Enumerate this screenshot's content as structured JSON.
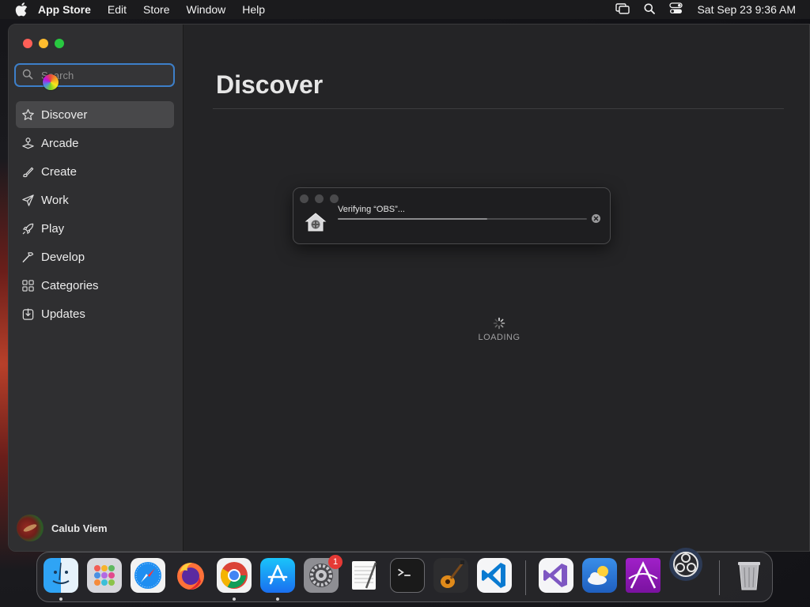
{
  "menubar": {
    "app_name": "App Store",
    "menus": [
      "Edit",
      "Store",
      "Window",
      "Help"
    ],
    "clock": "Sat Sep 23  9:36 AM"
  },
  "sidebar": {
    "search_placeholder": "Search",
    "items": [
      {
        "label": "Discover",
        "icon": "star-icon",
        "active": true
      },
      {
        "label": "Arcade",
        "icon": "joystick-icon",
        "active": false
      },
      {
        "label": "Create",
        "icon": "brush-icon",
        "active": false
      },
      {
        "label": "Work",
        "icon": "paperplane-icon",
        "active": false
      },
      {
        "label": "Play",
        "icon": "rocket-icon",
        "active": false
      },
      {
        "label": "Develop",
        "icon": "hammer-icon",
        "active": false
      },
      {
        "label": "Categories",
        "icon": "grid-icon",
        "active": false
      },
      {
        "label": "Updates",
        "icon": "download-icon",
        "active": false
      }
    ],
    "user_name": "Calub Viem"
  },
  "main": {
    "title": "Discover",
    "loading_text": "LOADING"
  },
  "verify_dialog": {
    "text": "Verifying “OBS”...",
    "progress": 0.6
  },
  "dock": {
    "apps": [
      {
        "name": "Finder",
        "icon": "finder-icon",
        "running": true
      },
      {
        "name": "Launchpad",
        "icon": "launchpad-icon",
        "running": false
      },
      {
        "name": "Safari",
        "icon": "safari-icon",
        "running": false
      },
      {
        "name": "Firefox",
        "icon": "firefox-icon",
        "running": false
      },
      {
        "name": "Chrome",
        "icon": "chrome-icon",
        "running": true
      },
      {
        "name": "App Store",
        "icon": "appstore-icon",
        "running": true
      },
      {
        "name": "System Settings",
        "icon": "settings-icon",
        "running": false,
        "badge": "1"
      },
      {
        "name": "TextEdit",
        "icon": "textedit-icon",
        "running": false
      },
      {
        "name": "Terminal",
        "icon": "terminal-icon",
        "running": false
      },
      {
        "name": "GarageBand",
        "icon": "guitar-icon",
        "running": false
      },
      {
        "name": "VS Code",
        "icon": "vscode-icon",
        "running": false
      },
      {
        "name": "Visual Studio",
        "icon": "visualstudio-icon",
        "running": false
      },
      {
        "name": "Weather",
        "icon": "weather-icon",
        "running": false
      },
      {
        "name": "Affinity",
        "icon": "affinity-icon",
        "running": false
      },
      {
        "name": "OBS",
        "icon": "obs-icon",
        "running": false
      },
      {
        "name": "Trash",
        "icon": "trash-icon",
        "running": false
      }
    ]
  },
  "colors": {
    "accent": "#3d7fc9",
    "badge": "#e53935",
    "close": "#fe5f57",
    "minimize": "#febc2e",
    "zoom": "#28c840"
  }
}
